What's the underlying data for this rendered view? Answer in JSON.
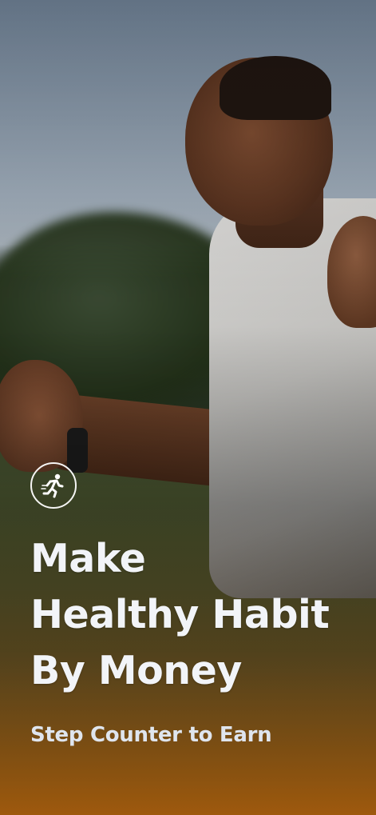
{
  "hero": {
    "headline_lines": [
      "Make",
      "Healthy Habit",
      "By Money"
    ],
    "subtitle": "Step Counter to Earn",
    "logo_icon": "running-person-icon"
  },
  "colors": {
    "headline": "#f2f4f8",
    "subtitle": "#dfe5ee",
    "bottom_glow": "#a86314"
  }
}
